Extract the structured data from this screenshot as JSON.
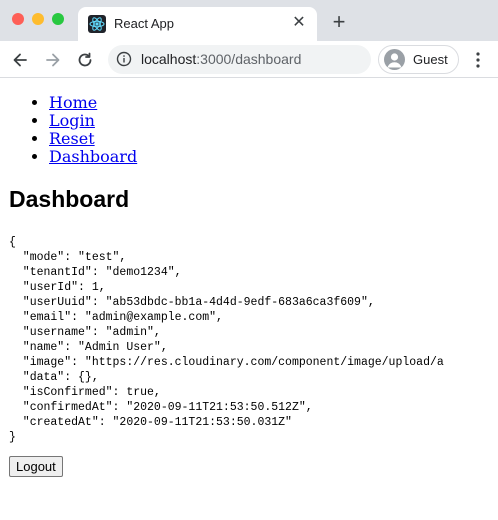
{
  "browser": {
    "tab_title": "React App",
    "url_host": "localhost",
    "url_path": ":3000/dashboard",
    "profile_label": "Guest",
    "new_tab_symbol": "+",
    "close_symbol": "✕",
    "accent": "#61dafb"
  },
  "nav": {
    "items": [
      "Home",
      "Login",
      "Reset",
      "Dashboard"
    ]
  },
  "page": {
    "title": "Dashboard",
    "json_lines": [
      "{",
      "  \"mode\": \"test\",",
      "  \"tenantId\": \"demo1234\",",
      "  \"userId\": 1,",
      "  \"userUuid\": \"ab53dbdc-bb1a-4d4d-9edf-683a6ca3f609\",",
      "  \"email\": \"admin@example.com\",",
      "  \"username\": \"admin\",",
      "  \"name\": \"Admin User\",",
      "  \"image\": \"https://res.cloudinary.com/component/image/upload/a",
      "  \"data\": {},",
      "  \"isConfirmed\": true,",
      "  \"confirmedAt\": \"2020-09-11T21:53:50.512Z\",",
      "  \"createdAt\": \"2020-09-11T21:53:50.031Z\"",
      "}"
    ],
    "logout_label": "Logout"
  }
}
